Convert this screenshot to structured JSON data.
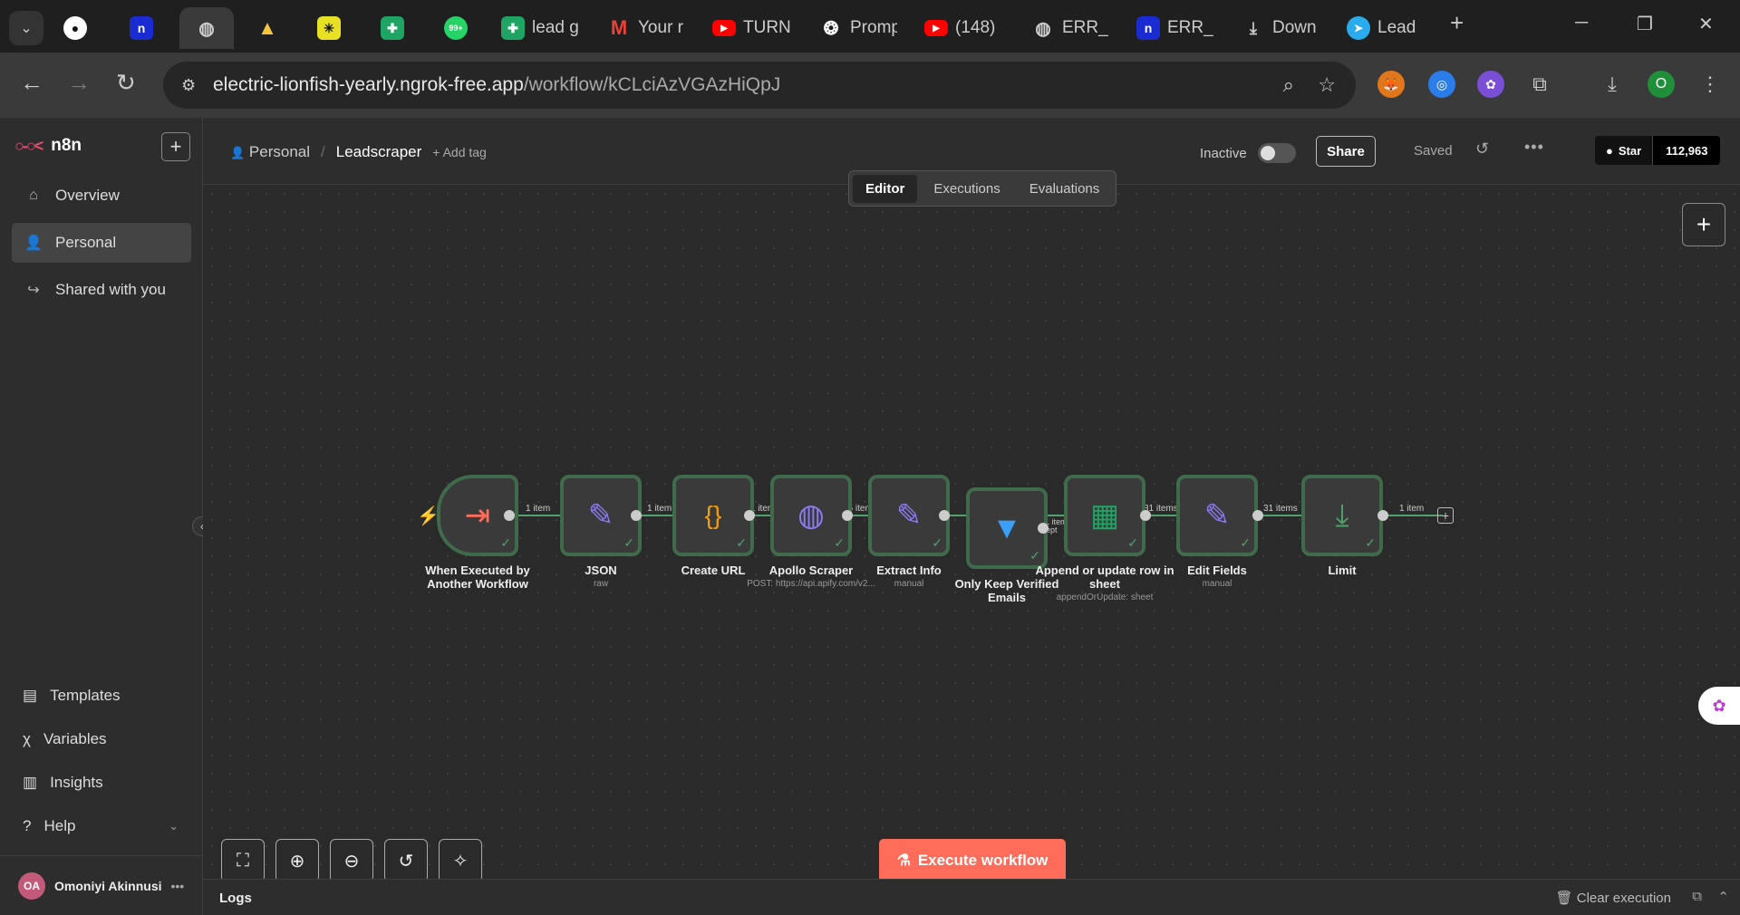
{
  "browser": {
    "tabs": [
      {
        "label": "",
        "icon": "github-icon",
        "color": "#ffffff"
      },
      {
        "label": "",
        "icon": "n-icon",
        "color": "#1a2bd1"
      },
      {
        "label": "",
        "icon": "globe-icon",
        "color": "#cccccc",
        "active": true
      },
      {
        "label": "",
        "icon": "apollo-icon",
        "color": "#f5c542"
      },
      {
        "label": "",
        "icon": "asterisk-icon",
        "color": "#e8e022"
      },
      {
        "label": "",
        "icon": "sheets-icon",
        "color": "#1fa463"
      },
      {
        "label": "",
        "icon": "whatsapp-icon",
        "color": "#25d366",
        "badge": "99+"
      },
      {
        "label": "lead g",
        "icon": "sheets-icon",
        "color": "#1fa463"
      },
      {
        "label": "Your r",
        "icon": "gmail-icon",
        "color": "#ea4335"
      },
      {
        "label": "TURN",
        "icon": "youtube-icon",
        "color": "#ff0000"
      },
      {
        "label": "Promp",
        "icon": "openai-icon",
        "color": "#ffffff"
      },
      {
        "label": "(148)",
        "icon": "youtube-icon",
        "color": "#ff0000"
      },
      {
        "label": "ERR_N",
        "icon": "globe-icon",
        "color": "#cccccc"
      },
      {
        "label": "ERR_N",
        "icon": "n-icon",
        "color": "#1a2bd1"
      },
      {
        "label": "Down",
        "icon": "download-icon",
        "color": "#cccccc"
      },
      {
        "label": "Lead",
        "icon": "telegram-icon",
        "color": "#2aabee"
      }
    ],
    "url_host": "electric-lionfish-yearly.ngrok-free.app",
    "url_path": "/workflow/kCLciAzVGAzHiQpJ",
    "profile_letter": "O"
  },
  "sidebar": {
    "brand": "n8n",
    "items": [
      {
        "label": "Overview",
        "icon": "home-icon"
      },
      {
        "label": "Personal",
        "icon": "user-icon",
        "active": true
      },
      {
        "label": "Shared with you",
        "icon": "share-icon"
      }
    ],
    "bottom": [
      {
        "label": "Templates",
        "icon": "templates-icon"
      },
      {
        "label": "Variables",
        "icon": "variables-icon"
      },
      {
        "label": "Insights",
        "icon": "insights-icon"
      },
      {
        "label": "Help",
        "icon": "help-icon"
      }
    ],
    "user": {
      "initials": "OA",
      "name": "Omoniyi Akinnusi"
    }
  },
  "header": {
    "project": "Personal",
    "workflow": "Leadscraper",
    "add_tag": "+ Add tag",
    "status": "Inactive",
    "share": "Share",
    "saved": "Saved",
    "github_star": "Star",
    "github_count": "112,963"
  },
  "canvas_tabs": [
    "Editor",
    "Executions",
    "Evaluations"
  ],
  "nodes": [
    {
      "label": "When Executed by Another Workflow",
      "sub": "",
      "icon": "trigger-icon",
      "color": "#ff6d5a"
    },
    {
      "label": "JSON",
      "sub": "raw",
      "icon": "pencil-icon",
      "color": "#8b7cf6"
    },
    {
      "label": "Create URL",
      "sub": "",
      "icon": "code-icon",
      "color": "#f59e0b"
    },
    {
      "label": "Apollo Scraper",
      "sub": "POST: https://api.apify.com/v2...",
      "icon": "globe-icon",
      "color": "#8b7cf6"
    },
    {
      "label": "Extract Info",
      "sub": "manual",
      "icon": "pencil-icon",
      "color": "#8b7cf6"
    },
    {
      "label": "Only Keep Verified Emails",
      "sub": "",
      "icon": "filter-icon",
      "color": "#3b9ff5"
    },
    {
      "label": "Append or update row in sheet",
      "sub": "appendOrUpdate: sheet",
      "icon": "sheets-icon",
      "color": "#1fa463"
    },
    {
      "label": "Edit Fields",
      "sub": "manual",
      "icon": "pencil-icon",
      "color": "#8b7cf6"
    },
    {
      "label": "Limit",
      "sub": "",
      "icon": "limit-icon",
      "color": "#4fa36a"
    }
  ],
  "edges": [
    "1 item",
    "1 item",
    "1 item",
    "35 items",
    "",
    "31 items Kept",
    "31 items",
    "31 items",
    "1 item"
  ],
  "execute": "Execute workflow",
  "logs": {
    "title": "Logs",
    "clear": "Clear execution"
  }
}
